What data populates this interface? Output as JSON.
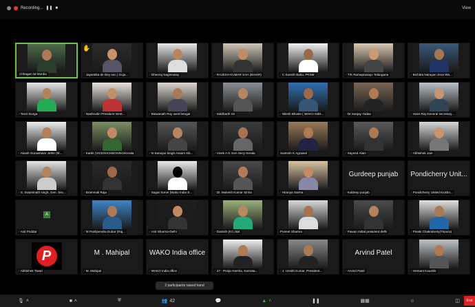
{
  "topbar": {
    "recording_label": "Recording...",
    "view_label": "View"
  },
  "participants": [
    {
      "name": "Chhagan lal Murdia",
      "muted": false,
      "active": true,
      "hand": "",
      "skin": "#b07a55",
      "shirt": "#2c3e2c",
      "bg": "#4d6a4a"
    },
    {
      "name": "Jayantika de Dey sec.) Guja...",
      "muted": true,
      "active": false,
      "hand": "✋",
      "skin": "#c9926a",
      "shirt": "#556",
      "bg": "#2b2b2b"
    },
    {
      "name": "Dheeraj Nagmnaraj",
      "muted": true,
      "active": false,
      "hand": "",
      "skin": "#b98560",
      "shirt": "#ddd",
      "bg": "#e8e8e8"
    },
    {
      "name": "RAJESH KUMAR SAH (BIHAR)",
      "muted": true,
      "active": false,
      "hand": "",
      "skin": "#c08c66",
      "shirt": "#333",
      "bg": "#cfc6b8"
    },
    {
      "name": "C Suresh Babu, PKSM",
      "muted": true,
      "active": false,
      "hand": "",
      "skin": "#9a6a48",
      "shirt": "#fff",
      "bg": "#f2f2f2"
    },
    {
      "name": "T/K Ramaprasayu Telangana",
      "muted": true,
      "active": false,
      "hand": "",
      "skin": "#c99a74",
      "shirt": "#444",
      "bg": "#d9c7b0"
    },
    {
      "name": "Bichitra Narayan Jena Wa...",
      "muted": true,
      "active": false,
      "hand": "",
      "skin": "#a87552",
      "shirt": "#236",
      "bg": "#3a5a7a"
    },
    {
      "name": "Tenzi Durga",
      "muted": true,
      "active": false,
      "hand": "",
      "skin": "#b4825c",
      "shirt": "#2a5",
      "bg": "#e6e6e6"
    },
    {
      "name": "Nashrudin President WAK...",
      "muted": true,
      "active": false,
      "hand": "",
      "skin": "#c28e68",
      "shirt": "#b33",
      "bg": "#e9e4dc"
    },
    {
      "name": "Biswanath Roy west bengal",
      "muted": true,
      "active": false,
      "hand": "",
      "skin": "#a97a58",
      "shirt": "#445",
      "bg": "#ddd8cf"
    },
    {
      "name": "Siddharth Sir",
      "muted": true,
      "active": false,
      "hand": "",
      "skin": "#b68862",
      "shirt": "#555",
      "bg": "#8a8f94"
    },
    {
      "name": "Nilesh Bhosle ( WAKO INDI...",
      "muted": true,
      "active": false,
      "hand": "",
      "skin": "#9c6a48",
      "shirt": "#357",
      "bg": "#2f6fb0"
    },
    {
      "name": "Dr Sanjay Yadav",
      "muted": true,
      "active": false,
      "hand": "",
      "skin": "#b07a55",
      "shirt": "#222",
      "bg": "#7a6655"
    },
    {
      "name": "Hans Raj General secretary...",
      "muted": true,
      "active": false,
      "hand": "",
      "skin": "#c59670",
      "shirt": "#345",
      "bg": "#b8c3c8"
    },
    {
      "name": "Akash Gunashwar Jethe (M...",
      "muted": true,
      "active": false,
      "hand": "",
      "skin": "#b3805a",
      "shirt": "#fff",
      "bg": "#eee"
    },
    {
      "name": "Kartik (VICE/KICKBOXING/Kerala",
      "muted": true,
      "active": false,
      "hand": "",
      "skin": "#c08a62",
      "shirt": "#363",
      "bg": "#7b8f63"
    },
    {
      "name": "N Sanayai Singh Assam Kik...",
      "muted": true,
      "active": false,
      "hand": "",
      "skin": "#b58660",
      "shirt": "#444",
      "bg": "#555"
    },
    {
      "name": "Vivek A G Gen Secy Kerala",
      "muted": true,
      "active": false,
      "hand": "",
      "skin": "#a67450",
      "shirt": "#666",
      "bg": "#3b3b3b"
    },
    {
      "name": "Santosh K Agrawal",
      "muted": false,
      "active": false,
      "hand": "",
      "skin": "#b07a55",
      "shirt": "#224",
      "bg": "#9a7a5a"
    },
    {
      "name": "Sayeed Alam",
      "muted": true,
      "active": false,
      "hand": "",
      "skin": "#a87a56",
      "shirt": "#333",
      "bg": "#5a5a5a"
    },
    {
      "name": "Abhishek Jain",
      "muted": true,
      "active": false,
      "hand": "",
      "skin": "#c8966e",
      "shirt": "#777",
      "bg": "#d8d8d8"
    },
    {
      "name": "S. Swaminath singh, Gen. Sec...",
      "muted": true,
      "active": false,
      "hand": "",
      "skin": "#b4845e",
      "shirt": "#ccc",
      "bg": "#e5e5e5"
    },
    {
      "name": "Brammali Raja",
      "muted": true,
      "active": false,
      "hand": "",
      "skin": "#9a6a48",
      "shirt": "#333",
      "bg": "#2a2a2a"
    },
    {
      "name": "Sagar Surve (Wako India S...",
      "muted": true,
      "active": false,
      "hand": "",
      "skin": "#000",
      "shirt": "#fff",
      "bg": "#eaeaea"
    },
    {
      "name": "Dr. Mukesh Kumar Sinha",
      "muted": true,
      "active": false,
      "hand": "",
      "skin": "#b27c56",
      "shirt": "#555",
      "bg": "#4a4a4a"
    },
    {
      "name": "Hiranya Sarma",
      "muted": true,
      "active": false,
      "hand": "",
      "skin": "#c28c64",
      "shirt": "#88a",
      "bg": "#d7c3a3"
    },
    {
      "name": "Kuldeep punjab",
      "muted": true,
      "active": false,
      "hand": "",
      "bigtext": "Gurdeep punjab"
    },
    {
      "name": "Pondicherry United Kickbo...",
      "muted": true,
      "active": false,
      "hand": "",
      "bigtext": "Pondicherry Unit..."
    },
    {
      "name": "Anil Poddar",
      "muted": true,
      "active": false,
      "hand": "",
      "greenbox": "A"
    },
    {
      "name": "M Pushpendra Dubar (Raj...",
      "muted": true,
      "active": false,
      "hand": "",
      "skin": "#b07a55",
      "shirt": "#2a5c8a",
      "bg": "#3f86c9"
    },
    {
      "name": "Anil Sharma-Delhi",
      "muted": true,
      "active": false,
      "hand": "",
      "skin": "#c08a62",
      "shirt": "#333",
      "bg": "#1e1e1e"
    },
    {
      "name": "Daniish (Kr) J&K",
      "muted": true,
      "active": false,
      "hand": "",
      "skin": "#b88a62",
      "shirt": "#2a7",
      "bg": "#9ab07a"
    },
    {
      "name": "Puneet Sharma",
      "muted": false,
      "active": false,
      "hand": "",
      "skin": "#a87450",
      "shirt": "#ddd",
      "bg": "#d9d9d9"
    },
    {
      "name": "Pawan mittal president delhi",
      "muted": true,
      "active": false,
      "hand": "",
      "skin": "#b4825c",
      "shirt": "#333",
      "bg": "#4a4a4a"
    },
    {
      "name": "Pinaki Chakraborty(Tripura)",
      "muted": true,
      "active": false,
      "hand": "",
      "skin": "#a87a56",
      "shirt": "#2266aa",
      "bg": "#e0e0e0"
    },
    {
      "name": "Abhishek Tiwari",
      "muted": true,
      "active": false,
      "hand": "",
      "logo": "P"
    },
    {
      "name": "M. Mahipal",
      "muted": true,
      "active": false,
      "hand": "",
      "bigtext": "M . Mahipal"
    },
    {
      "name": "WAKO India office",
      "muted": true,
      "active": false,
      "hand": "",
      "bigtext": "WAKO India office"
    },
    {
      "name": "27 - Pooja Harsha, Karnata...",
      "muted": true,
      "active": false,
      "hand": "",
      "skin": "#b07a55",
      "shirt": "#222",
      "bg": "#f0f0f0"
    },
    {
      "name": "J. Unnith Kumar, President...",
      "muted": true,
      "active": false,
      "hand": "",
      "skin": "#a87a56",
      "shirt": "#222",
      "bg": "#8a8a8a"
    },
    {
      "name": "Arvind Patel",
      "muted": true,
      "active": false,
      "hand": "",
      "bigtext": "Arvind Patel"
    },
    {
      "name": "Hemant Kaushik",
      "muted": true,
      "active": false,
      "hand": "",
      "skin": "#b07a55",
      "shirt": "#555",
      "bg": "#bfc3c7"
    }
  ],
  "notice": "2 participants raised hand",
  "toolbar": {
    "mic_icon": "🎙",
    "video_icon": "■",
    "security_icon": "⛨",
    "participants_icon": "👥",
    "participants_count": "42",
    "chat_icon": "💬",
    "share_icon": "▲",
    "record_icon": "❚❚",
    "reactions_icon": "☺",
    "apps_icon": "◫",
    "end_label": "End"
  }
}
